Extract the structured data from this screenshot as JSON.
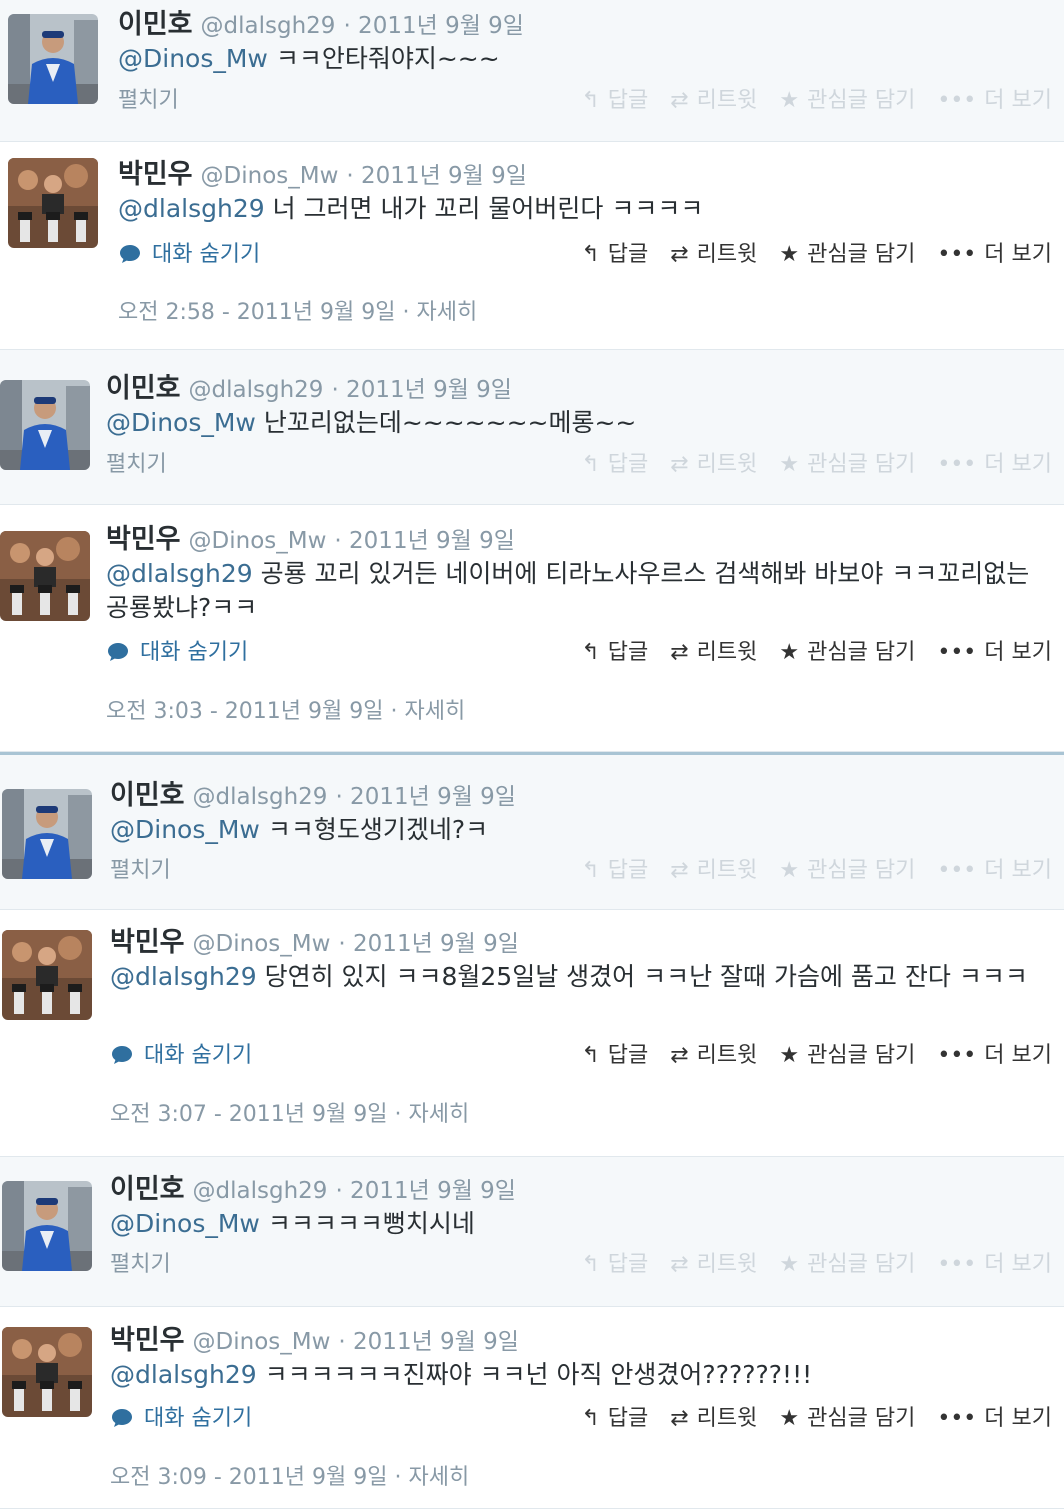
{
  "users": {
    "minho": {
      "name": "이민호",
      "handle": "@dlalsgh29"
    },
    "minwoo": {
      "name": "박민우",
      "handle": "@Dinos_Mw"
    }
  },
  "actions": {
    "reply": "답글",
    "retweet": "리트윗",
    "favorite": "관심글 담기",
    "more": "더 보기",
    "more_glyph": "•••"
  },
  "labels": {
    "expand": "펼치기",
    "hide_conversation": "대화 숨기기",
    "details": "자세히"
  },
  "icons": {
    "reply": "reply-arrow-icon",
    "retweet": "retweet-icon",
    "favorite": "star-icon",
    "conversation": "speech-bubble-icon"
  },
  "tweets": [
    {
      "user": "이민호",
      "handle": "@dlalsgh29",
      "date": "· 2011년 9월 9일",
      "mention": "@Dinos_Mw",
      "text": " ㅋㅋ안타줘야지~~~"
    },
    {
      "user": "박민우",
      "handle": "@Dinos_Mw",
      "date": "· 2011년 9월 9일",
      "mention": "@dlalsgh29",
      "text": " 너 그러면 내가 꼬리 물어버린다 ㅋㅋㅋㅋ",
      "timestamp": "오전 2:58 - 2011년 9월 9일"
    },
    {
      "user": "이민호",
      "handle": "@dlalsgh29",
      "date": "· 2011년 9월 9일",
      "mention": "@Dinos_Mw",
      "text": " 난꼬리없는데~~~~~~~메롱~~"
    },
    {
      "user": "박민우",
      "handle": "@Dinos_Mw",
      "date": "· 2011년 9월 9일",
      "mention": "@dlalsgh29",
      "text": " 공룡 꼬리 있거든 네이버에 티라노사우르스 검색해봐 바보야 ㅋㅋ꼬리없는 공룡봤냐?ㅋㅋ",
      "timestamp": "오전 3:03 - 2011년 9월 9일"
    },
    {
      "user": "이민호",
      "handle": "@dlalsgh29",
      "date": "· 2011년 9월 9일",
      "mention": "@Dinos_Mw",
      "text": " ㅋㅋ형도생기겠네?ㅋ"
    },
    {
      "user": "박민우",
      "handle": "@Dinos_Mw",
      "date": "· 2011년 9월 9일",
      "mention": "@dlalsgh29",
      "text": " 당연히 있지 ㅋㅋ8월25일날 생겼어 ㅋㅋ난 잘때 가슴에 품고 잔다 ㅋㅋㅋ",
      "timestamp": "오전 3:07 - 2011년 9월 9일"
    },
    {
      "user": "이민호",
      "handle": "@dlalsgh29",
      "date": "· 2011년 9월 9일",
      "mention": "@Dinos_Mw",
      "text": " ㅋㅋㅋㅋㅋ뻥치시네"
    },
    {
      "user": "박민우",
      "handle": "@Dinos_Mw",
      "date": "· 2011년 9월 9일",
      "mention": "@dlalsgh29",
      "text": " ㅋㅋㅋㅋㅋㅋ진짜야 ㅋㅋ넌 아직 안생겼어??????!!!",
      "timestamp": "오전 3:09 - 2011년 9월 9일"
    }
  ],
  "colors": {
    "mention": "#3b6d92",
    "conversation_link": "#2f6f9f",
    "reply_background": "#f5f8fa",
    "meta_gray": "#8899a6",
    "section_divider": "#a9c4d4"
  }
}
